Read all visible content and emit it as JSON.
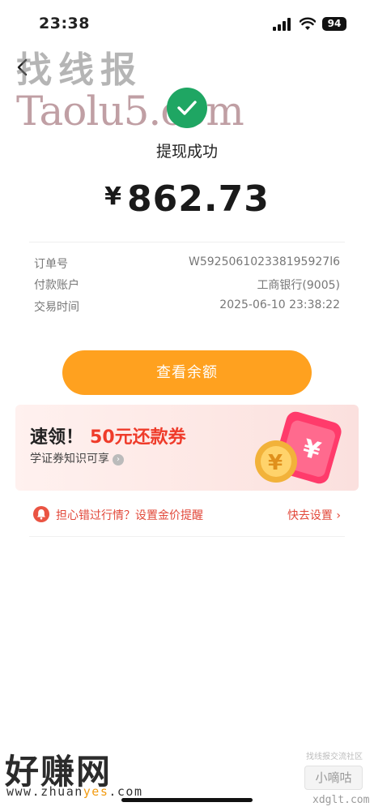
{
  "status_bar": {
    "time": "23:38",
    "battery": "94"
  },
  "watermarks": {
    "top_left_cn": "找线报",
    "top_left_en": "Taolu5.com",
    "bottom_left_big": "好赚网",
    "bottom_left_url_pre": "www.zhuan",
    "bottom_left_url_hl": "yes",
    "bottom_left_url_post": ".com",
    "bottom_right_top": "找线报交流社区",
    "bottom_right_box": "小嘀咕",
    "bottom_right_url": "xdglt.com"
  },
  "result": {
    "title": "提现成功",
    "currency": "¥",
    "amount": "862.73"
  },
  "details": [
    {
      "label": "订单号",
      "value": "W592506102338195927l6"
    },
    {
      "label": "付款账户",
      "value": "工商银行(9005)"
    },
    {
      "label": "交易时间",
      "value": "2025-06-10 23:38:22"
    }
  ],
  "actions": {
    "view_balance": "查看余额"
  },
  "promo": {
    "title_prefix": "速领！",
    "title_highlight": "50元还款券",
    "subtitle": "学证券知识可享",
    "art_symbol": "¥"
  },
  "alert": {
    "text": "担心错过行情？设置金价提醒",
    "link": "快去设置 ›"
  },
  "colors": {
    "success": "#1fa663",
    "primary_button": "#ffa11f",
    "promo_red": "#ef3b2a"
  }
}
